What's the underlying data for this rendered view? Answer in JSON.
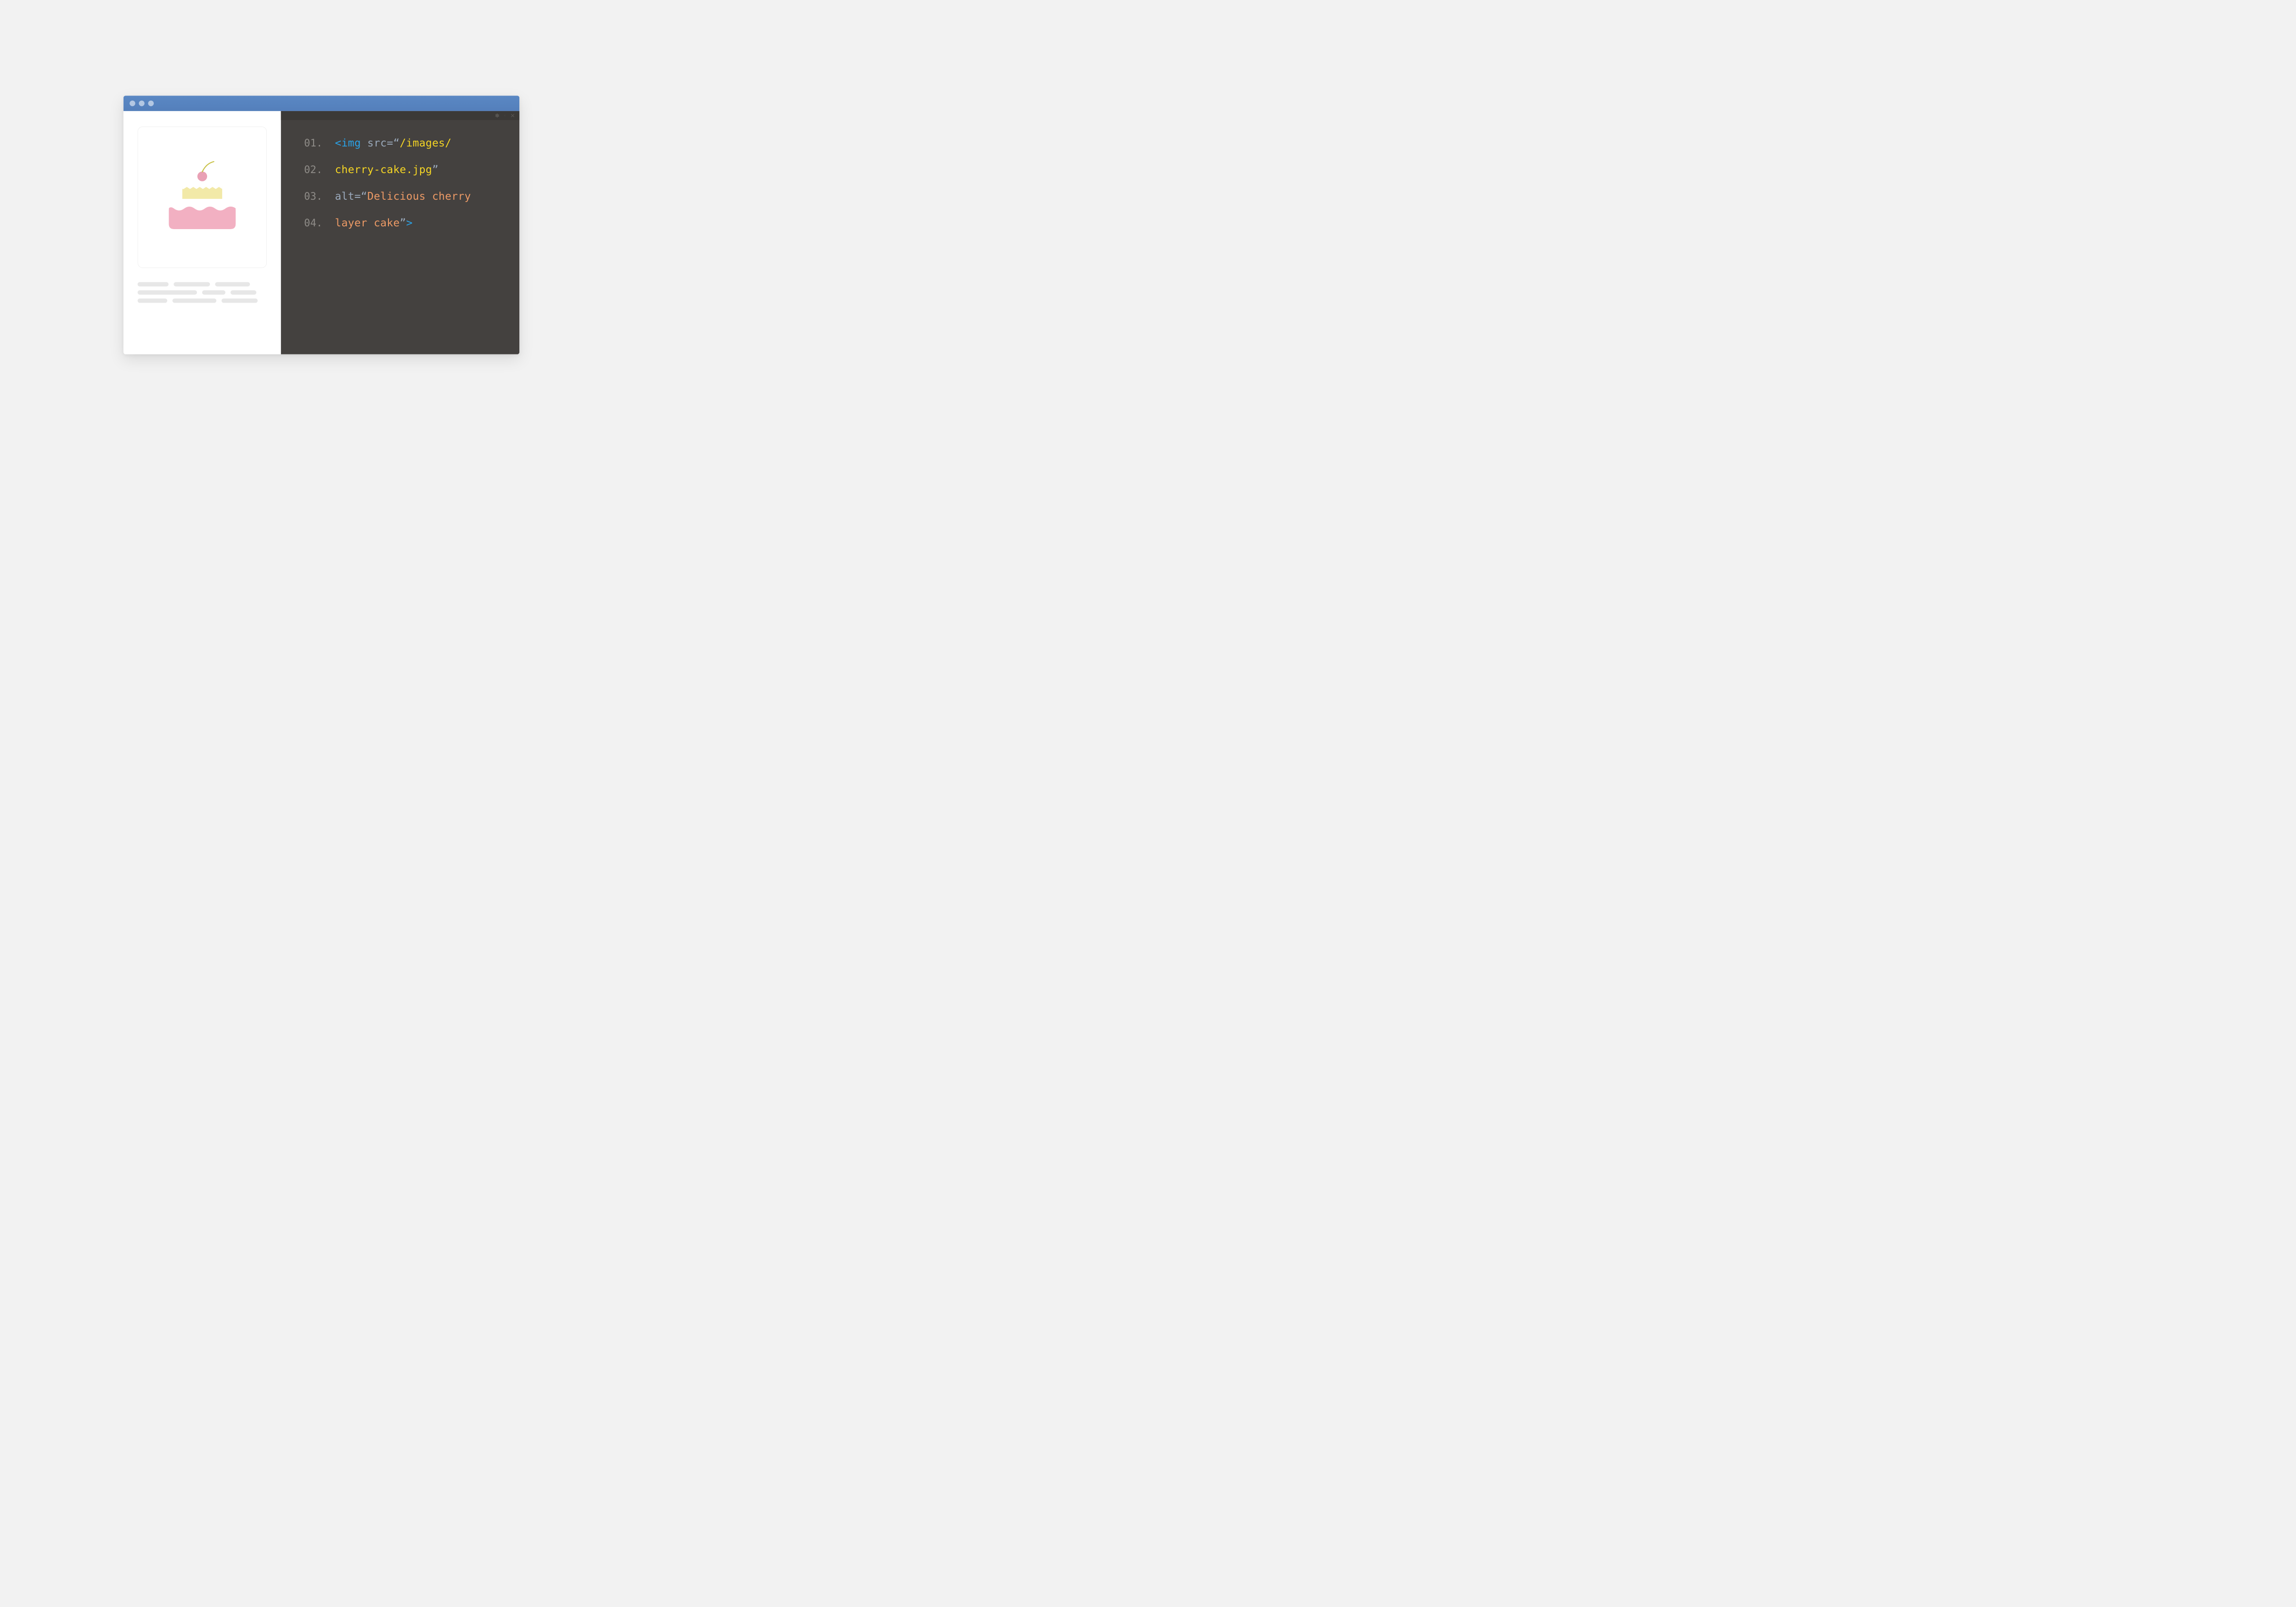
{
  "window": {
    "traffic_lights": 3
  },
  "preview": {
    "illustration": "cake-illustration",
    "placeholder_line_widths_pct": [
      24,
      28,
      27,
      46,
      18,
      20,
      23,
      34,
      28
    ]
  },
  "code": {
    "controls": [
      "gear-icon",
      "divider-icon",
      "close-icon"
    ],
    "lines": [
      {
        "num": "01.",
        "tokens": [
          {
            "t": "<",
            "c": "tok-tag"
          },
          {
            "t": "img",
            "c": "tok-tag"
          },
          {
            "t": " ",
            "c": "tok-attr"
          },
          {
            "t": "src=“",
            "c": "tok-attr"
          },
          {
            "t": "/images/",
            "c": "tok-path"
          }
        ]
      },
      {
        "num": "02.",
        "tokens": [
          {
            "t": "cherry-cake.jpg",
            "c": "tok-path"
          },
          {
            "t": "”",
            "c": "tok-attr"
          }
        ]
      },
      {
        "num": "03.",
        "tokens": [
          {
            "t": "alt=“",
            "c": "tok-attr"
          },
          {
            "t": "Delicious cherry",
            "c": "tok-str"
          }
        ]
      },
      {
        "num": "04.",
        "tokens": [
          {
            "t": "layer cake",
            "c": "tok-str"
          },
          {
            "t": "”",
            "c": "tok-attr"
          },
          {
            "t": ">",
            "c": "tok-tag"
          }
        ]
      }
    ]
  },
  "colors": {
    "titlebar": "#5a88c4",
    "code_bg": "#44413f",
    "code_header": "#3b3937",
    "line_number": "#8f8c88",
    "tag": "#2aa3e8",
    "attr": "#9aa9bb",
    "path": "#f5d524",
    "string": "#ec9a66",
    "cake_base": "#f2b0c2",
    "cake_top": "#f2e9a8",
    "cherry": "#e9a1b5"
  }
}
